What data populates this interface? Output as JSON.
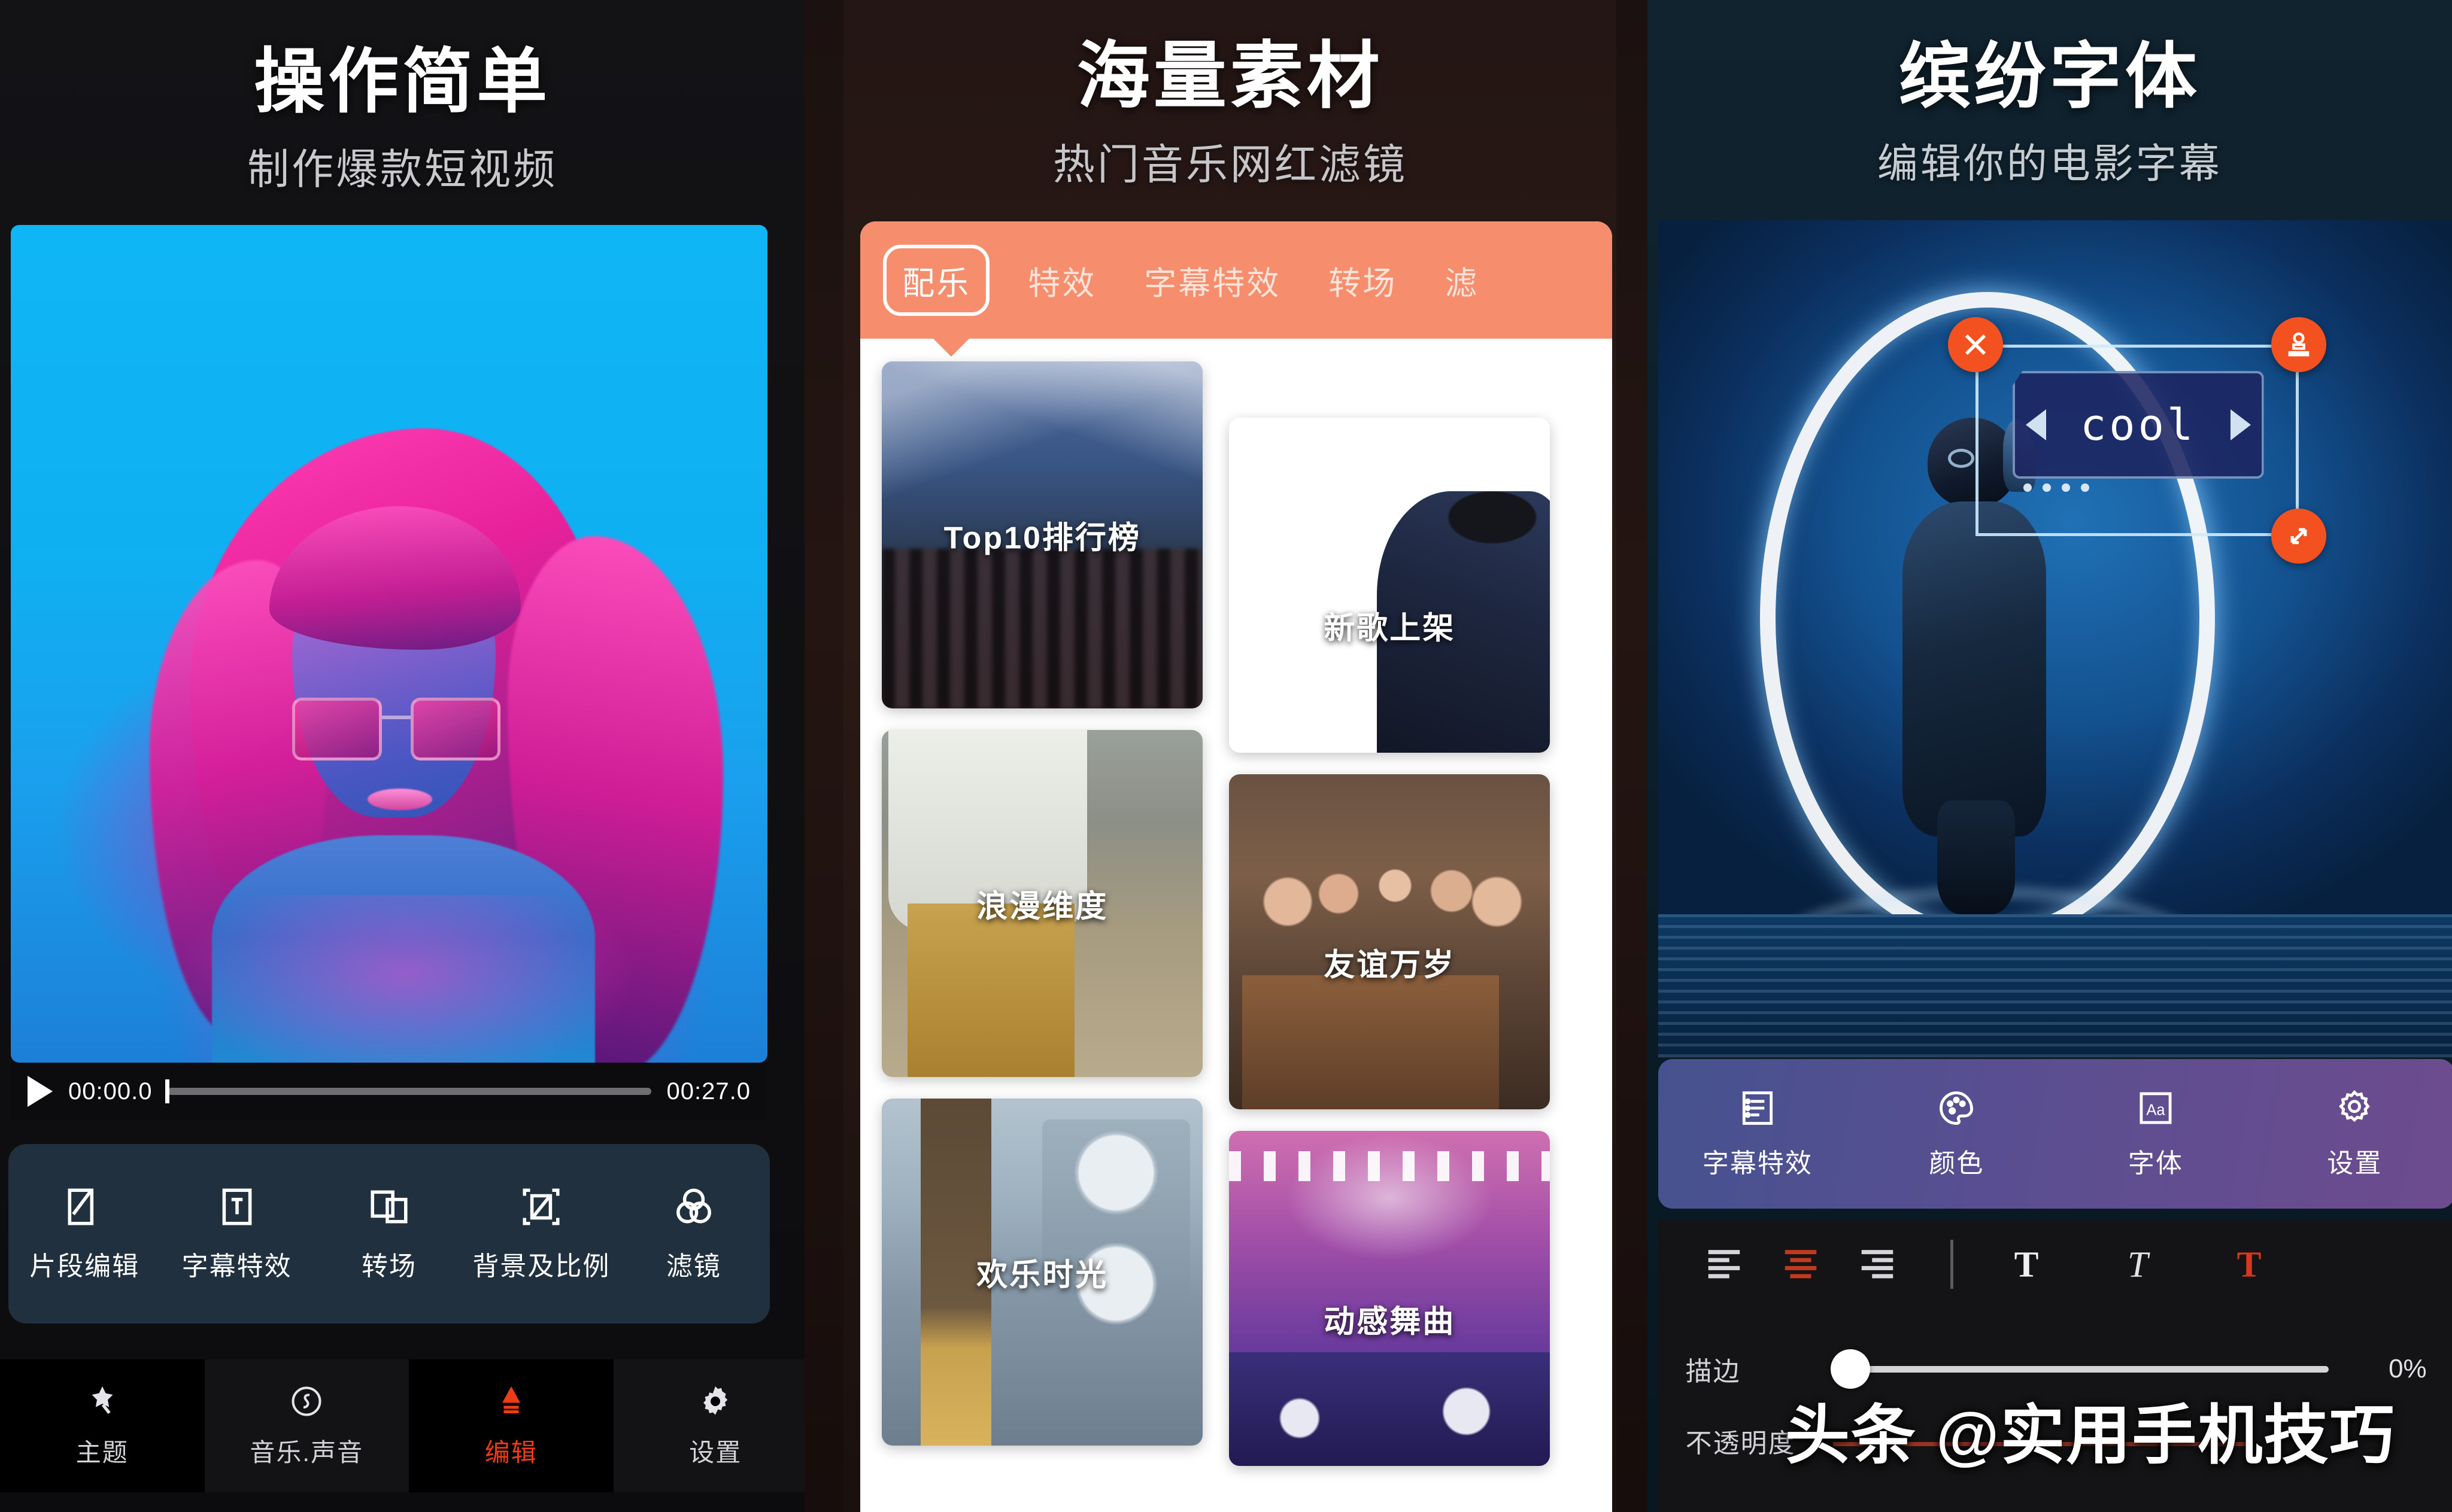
{
  "panels": {
    "left": {
      "title": "操作简单",
      "subtitle": "制作爆款短视频",
      "timeline": {
        "current": "00:00.0",
        "total": "00:27.0",
        "progress_percent": 0
      },
      "tools": [
        {
          "icon": "clip-edit-icon",
          "label": "片段编辑"
        },
        {
          "icon": "subtitle-effect-icon",
          "label": "字幕特效"
        },
        {
          "icon": "transition-icon",
          "label": "转场"
        },
        {
          "icon": "background-ratio-icon",
          "label": "背景及比例"
        },
        {
          "icon": "filter-icon",
          "label": "滤镜"
        }
      ],
      "nav": [
        {
          "icon": "magic-wand-icon",
          "label": "主题",
          "active": false
        },
        {
          "icon": "music-note-icon",
          "label": "音乐.声音",
          "active": false
        },
        {
          "icon": "edit-pen-icon",
          "label": "编辑",
          "active": true
        },
        {
          "icon": "gear-icon",
          "label": "设置",
          "active": false
        }
      ],
      "accent_active": "#ef3b16"
    },
    "middle": {
      "title": "海量素材",
      "subtitle": "热门音乐网红滤镜",
      "tabbar_color": "#f68e6e",
      "tabs": [
        {
          "label": "配乐",
          "active": true
        },
        {
          "label": "特效",
          "active": false
        },
        {
          "label": "字幕特效",
          "active": false
        },
        {
          "label": "转场",
          "active": false
        },
        {
          "label": "滤",
          "active": false
        }
      ],
      "cards_left": [
        {
          "label": "Top10排行榜",
          "art": "concert"
        },
        {
          "label": "浪漫维度",
          "art": "couple"
        },
        {
          "label": "欢乐时光",
          "art": "guitar"
        }
      ],
      "cards_right": [
        {
          "label": "新歌上架",
          "art": "wood"
        },
        {
          "label": "友谊万岁",
          "art": "party"
        },
        {
          "label": "动感舞曲",
          "art": "dj"
        }
      ]
    },
    "right": {
      "title": "缤纷字体",
      "subtitle": "编辑你的电影字幕",
      "canvas": {
        "text_chip": "cool",
        "buttons": [
          {
            "icon": "close-icon",
            "name": "close-text-button"
          },
          {
            "icon": "stamp-icon",
            "name": "stamp-text-button"
          },
          {
            "icon": "resize-icon",
            "name": "resize-text-button"
          }
        ]
      },
      "tools": [
        {
          "icon": "subtitle-list-icon",
          "label": "字幕特效"
        },
        {
          "icon": "palette-icon",
          "label": "颜色"
        },
        {
          "icon": "font-aa-icon",
          "label": "字体"
        },
        {
          "icon": "gear-icon",
          "label": "设置"
        }
      ],
      "format": [
        {
          "icon": "align-left-icon",
          "active": false
        },
        {
          "icon": "align-center-icon",
          "active": true
        },
        {
          "icon": "align-right-icon",
          "active": false
        },
        {
          "icon": "bold-t-icon",
          "active": false
        },
        {
          "icon": "italic-t-icon",
          "active": false
        },
        {
          "icon": "color-t-icon",
          "active": true
        }
      ],
      "sliders": [
        {
          "label": "描边",
          "value": "0%",
          "percent": 0
        },
        {
          "label": "不透明度",
          "value": "",
          "percent": 0
        }
      ],
      "accent_active": "#c23a1e",
      "toolbar_gradient_start": "#46528f",
      "toolbar_gradient_end": "#6d4c8e"
    }
  },
  "watermark": "头条 @实用手机技巧"
}
